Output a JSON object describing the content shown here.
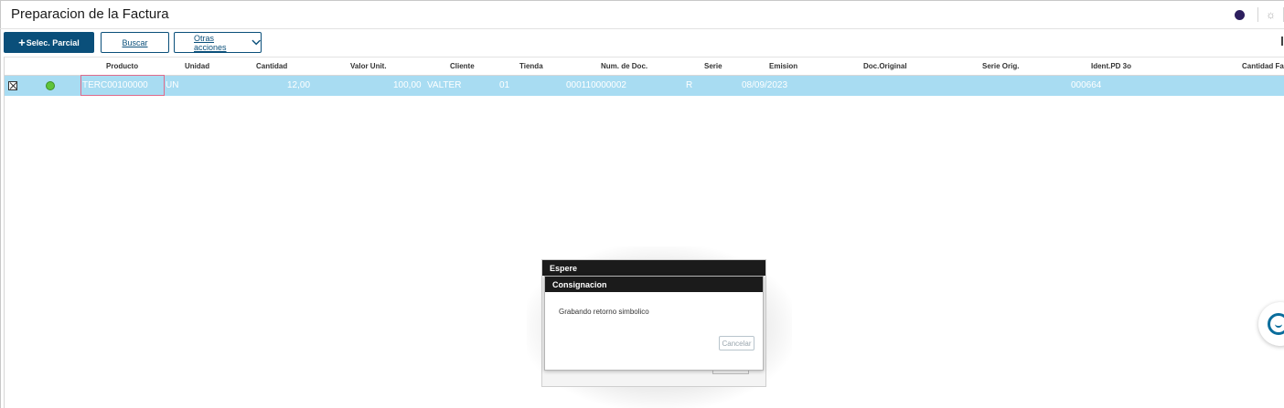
{
  "window": {
    "title": "Preparacion de la Factura"
  },
  "toolbar": {
    "selec_parcial_label": "Selec. Parcial",
    "buscar_label": "Buscar",
    "otras_acciones_label": "Otras acciones"
  },
  "icons": {
    "status_color": "#5fc43a",
    "primary_color": "#0a4f7a"
  },
  "grid": {
    "columns": [
      "Producto",
      "Unidad",
      "Cantidad",
      "Valor Unit.",
      "Cliente",
      "Tienda",
      "Num. de Doc.",
      "Serie",
      "Emision",
      "Doc.Original",
      "Serie Orig.",
      "Ident.PD 3o",
      "Cantidad Fa"
    ],
    "row": {
      "producto": "TERC00100000",
      "unidad": "UN",
      "cantidad": "12,00",
      "valor_unit": "100,00",
      "cliente": "VALTER",
      "tienda": "01",
      "num_doc": "000110000002",
      "serie": "R",
      "emision": "08/09/2023",
      "doc_original": "",
      "serie_orig": "",
      "ident_pd": "000664"
    }
  },
  "modal": {
    "outer_title": "Espere",
    "inner_title": "Consignacion",
    "message": "Grabando retorno simbolico",
    "cancel_label": "Cancelar"
  }
}
